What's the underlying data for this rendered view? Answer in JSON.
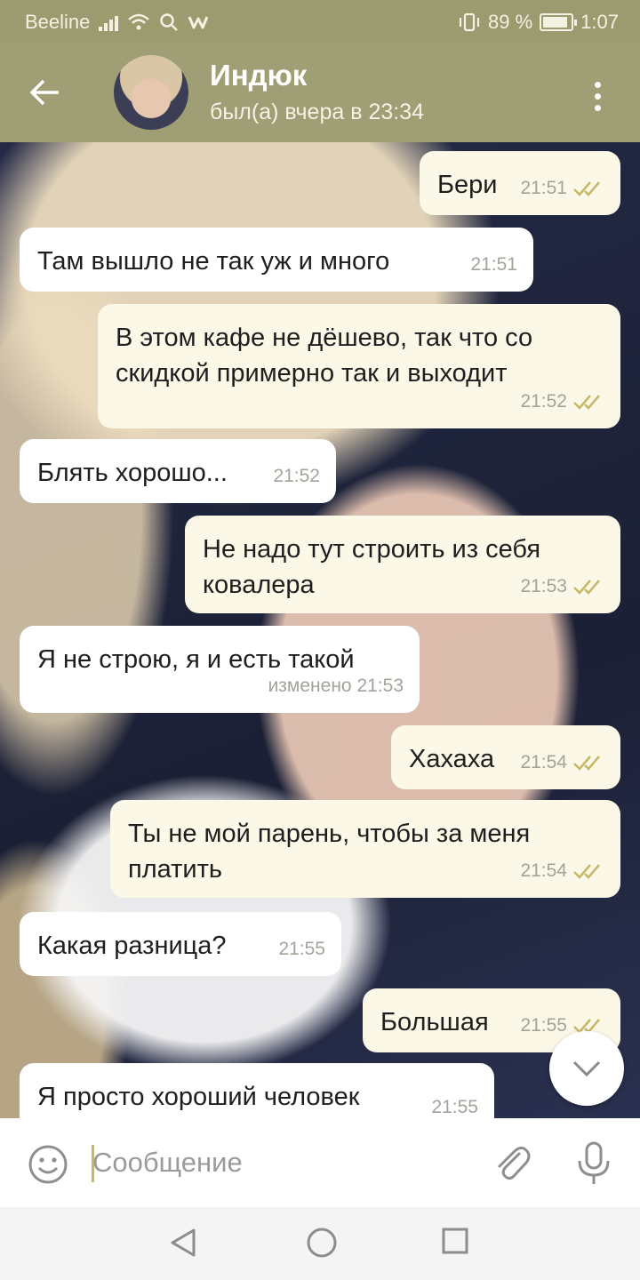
{
  "status_bar": {
    "carrier": "Beeline",
    "battery": "89 %",
    "battery_level": 0.89,
    "time": "1:07"
  },
  "header": {
    "title": "Индюк",
    "status": "был(а) вчера в 23:34"
  },
  "messages": [
    {
      "direction": "out",
      "text": "Бери",
      "time": "21:51",
      "read": true
    },
    {
      "direction": "in",
      "text": "Там вышло не так уж и много",
      "time": "21:51"
    },
    {
      "direction": "out",
      "text": "В этом кафе не дёшево, так что со скидкой примерно так и выходит",
      "time": "21:52",
      "read": true
    },
    {
      "direction": "in",
      "text": "Блять хорошо...",
      "time": "21:52"
    },
    {
      "direction": "out",
      "text": "Не надо тут строить из себя ковалера",
      "time": "21:53",
      "read": true
    },
    {
      "direction": "in",
      "text": "Я не строю, я и есть такой",
      "time": "изменено 21:53"
    },
    {
      "direction": "out",
      "text": "Хахаха",
      "time": "21:54",
      "read": true
    },
    {
      "direction": "out",
      "text": "Ты не мой парень, чтобы за меня платить",
      "time": "21:54",
      "read": true
    },
    {
      "direction": "in",
      "text": "Какая разница?",
      "time": "21:55"
    },
    {
      "direction": "out",
      "text": "Большая",
      "time": "21:55",
      "read": true
    },
    {
      "direction": "in",
      "text": "Я просто хороший человек",
      "time": "21:55"
    }
  ],
  "composer": {
    "placeholder": "Сообщение"
  },
  "colors": {
    "header": "#a09e74",
    "status_bar": "#9c9a6f",
    "outgoing_bubble": "#fbf8e7",
    "incoming_bubble": "#ffffff",
    "read_check": "#c7b869"
  },
  "icons": {
    "back": "arrow-left-icon",
    "menu": "more-vertical-icon",
    "scroll_down": "chevron-down-icon",
    "emoji": "smiley-icon",
    "attach": "paperclip-icon",
    "mic": "microphone-icon"
  }
}
